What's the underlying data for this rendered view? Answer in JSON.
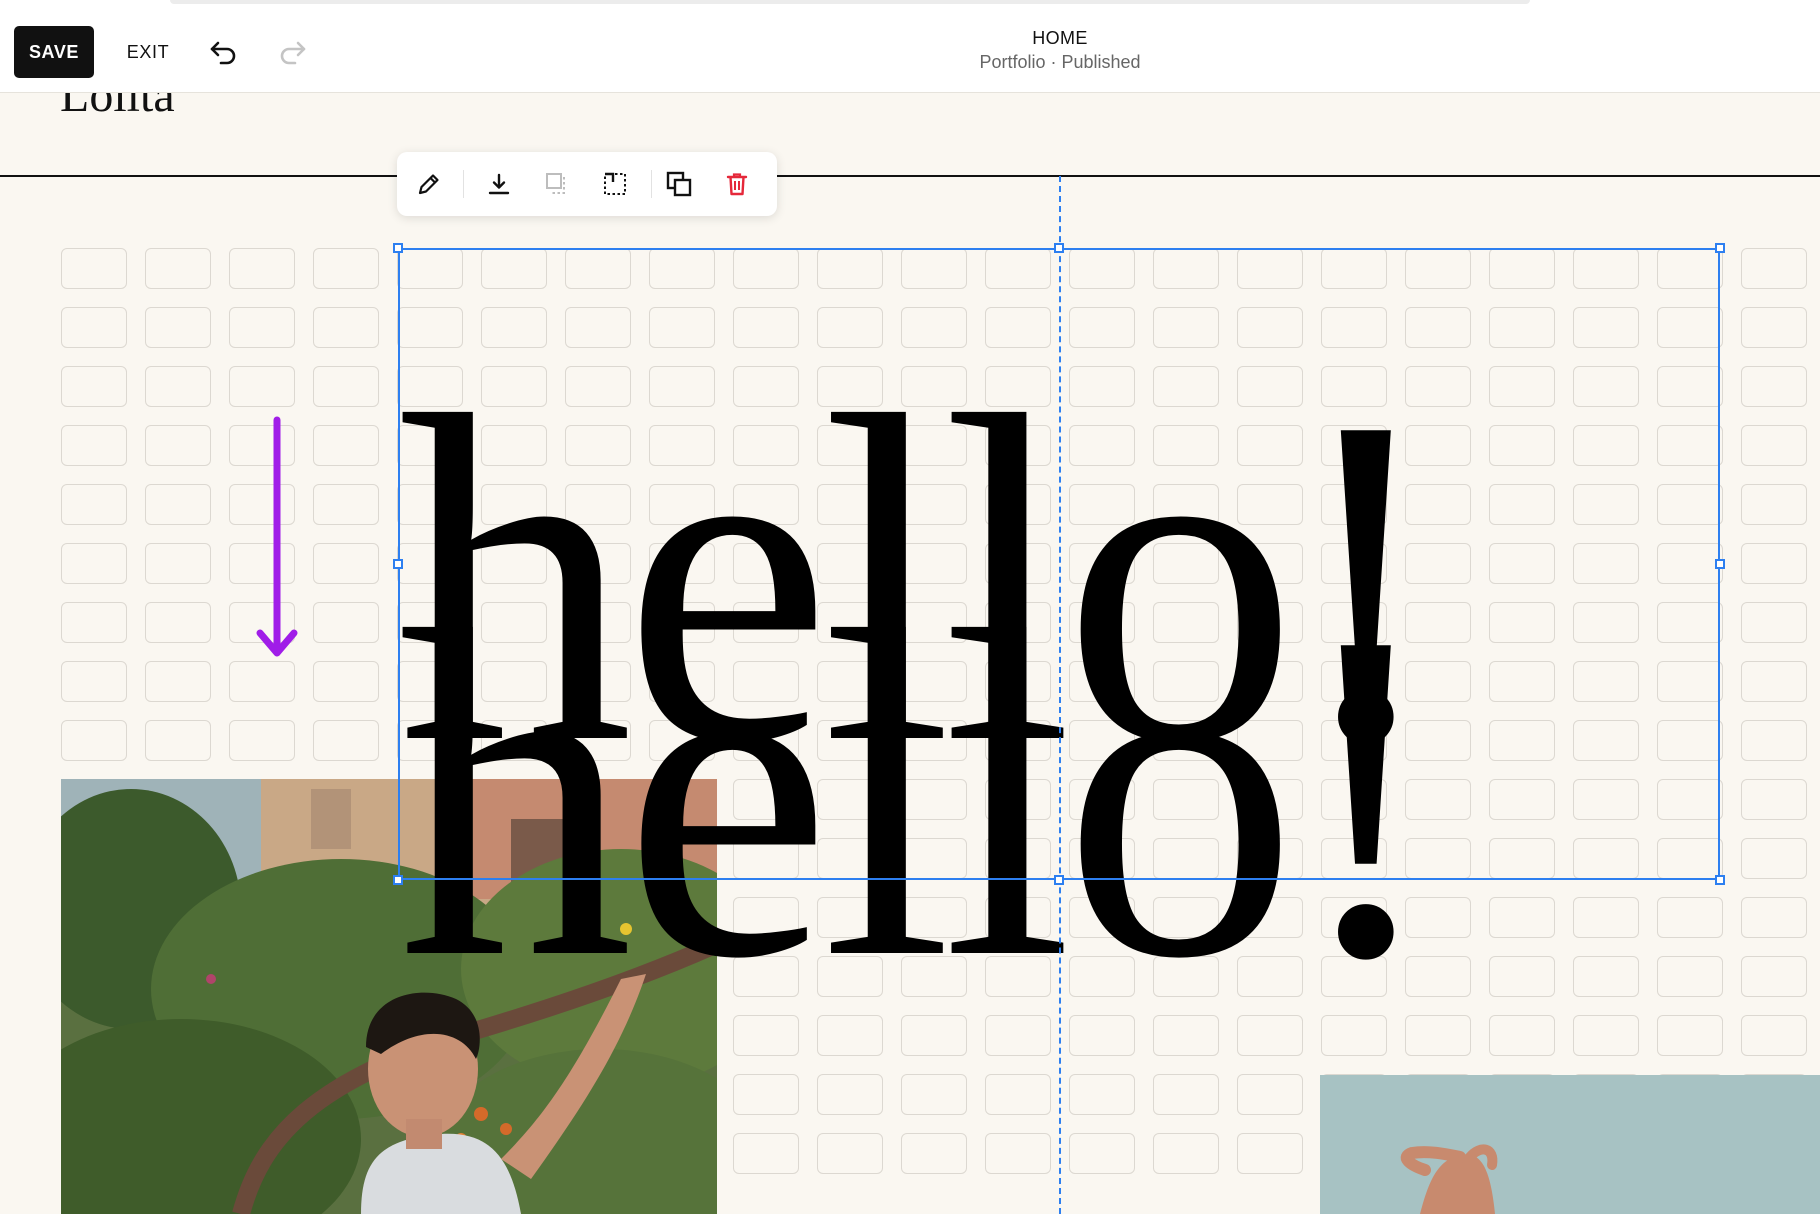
{
  "topbar": {
    "save_label": "SAVE",
    "exit_label": "EXIT",
    "page_title": "HOME",
    "page_subtitle": "Portfolio · Published"
  },
  "site": {
    "title": "Lolita"
  },
  "canvas": {
    "headline": "hello!"
  },
  "toolbar_icons": [
    "edit-pencil-icon",
    "download-icon",
    "crop-disabled-icon",
    "stretch-icon",
    "layer-arrange-icon",
    "delete-icon"
  ],
  "colors": {
    "accent": "#2d7ff0",
    "delete": "#e5283a",
    "arrow": "#a01de8",
    "background": "#faf7f1",
    "grid_cell_border": "#dcd8d1"
  }
}
